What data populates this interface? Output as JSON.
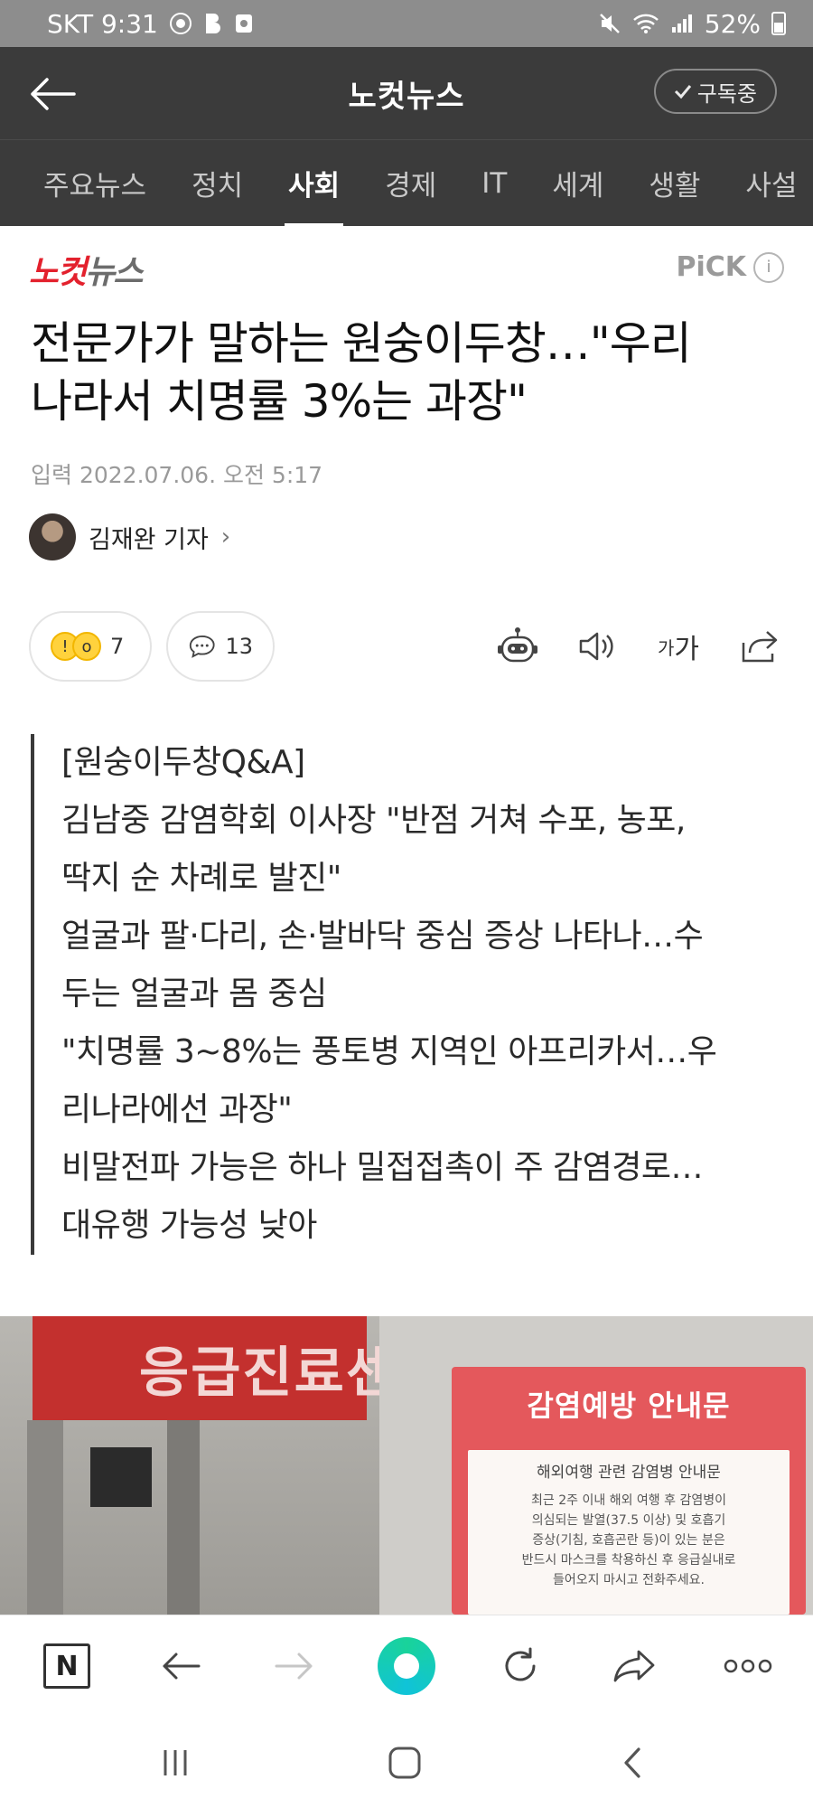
{
  "status_bar": {
    "carrier_time": "SKT 9:31",
    "battery": "52%",
    "battery_level": 0.52
  },
  "app_header": {
    "title": "노컷뉴스",
    "subscribe_label": "구독중"
  },
  "categories": {
    "items": [
      "주요뉴스",
      "정치",
      "사회",
      "경제",
      "IT",
      "세계",
      "생활",
      "사설"
    ],
    "active": "사회"
  },
  "article": {
    "brand": {
      "part1": "노컷",
      "part2": "뉴스"
    },
    "pick_label": "PiCK",
    "headline_line1": "전문가가 말하는 원숭이두창…\"우리",
    "headline_line2": "나라서 치명률 3%는 과장\"",
    "published": "입력 2022.07.06. 오전 5:17",
    "reporter": "김재완 기자"
  },
  "reactions": {
    "emoji_count": "7",
    "comment_count": "13",
    "font_size_label_small": "가",
    "font_size_label_large": "가"
  },
  "summary": {
    "lines": [
      "[원숭이두창Q&A]",
      "김남중 감염학회 이사장 \"반점 거쳐 수포, 농포,",
      "딱지 순 차례로 발진\"",
      "얼굴과 팔·다리, 손·발바닥 중심 증상 나타나…수",
      "두는 얼굴과 몸 중심",
      "\"치명률 3~8%는 풍토병 지역인 아프리카서…우",
      "리나라에선 과장\"",
      "비말전파 가능은 하나 밀접접촉이 주 감염경로…",
      "대유행 가능성 낮아"
    ]
  },
  "image": {
    "sign_text": "응급진료센",
    "notice_title": "감염예방 안내문",
    "notice_subtitle": "해외여행 관련 감염병 안내문",
    "notice_lines": [
      "최근 2주 이내 해외 여행 후 감염병이",
      "의심되는 발열(37.5 이상) 및 호흡기",
      "증상(기침, 호흡곤란 등)이 있는 분은",
      "반드시 마스크를 착용하신 후 응급실내로",
      "들어오지 마시고 전화주세요."
    ]
  },
  "browser_toolbar": {
    "n_label": "N"
  },
  "icons": {
    "back": "arrow-left-icon",
    "check": "check-icon",
    "info": "info-icon",
    "robot": "robot-icon",
    "speaker": "speaker-icon",
    "share": "share-icon",
    "comment": "comment-icon",
    "reload": "reload-icon",
    "more": "more-dots-icon"
  },
  "colors": {
    "header_bg": "#3b3b3b",
    "brand_red": "#e3212d",
    "status_bar_bg": "#8d8d8d"
  }
}
